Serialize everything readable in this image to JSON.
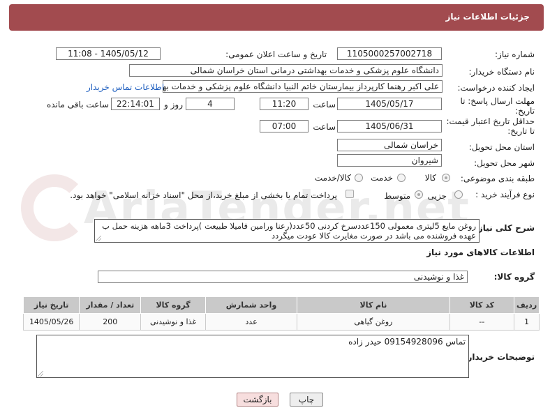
{
  "header": {
    "title": "جزئیات اطلاعات نیاز"
  },
  "fields": {
    "need_number_label": "شماره نیاز:",
    "need_number": "1105000257002718",
    "announce_label": "تاریخ و ساعت اعلان عمومی:",
    "announce_value": "1405/05/12 - 11:08",
    "buyer_org_label": "نام دستگاه خریدار:",
    "buyer_org": "دانشگاه علوم پزشکی و خدمات بهداشتی درمانی استان خراسان شمالی",
    "creator_label": "ایجاد کننده درخواست:",
    "creator": "علی اکبر رهنما کارپرداز بیمارستان خاتم النبیا دانشگاه علوم پزشکی و خدمات بهداشتی",
    "contact_link": "اطلاعات تماس خریدار",
    "reply_deadline_label_1": "مهلت ارسال پاسخ: تا",
    "reply_deadline_label_2": "تاریخ:",
    "reply_date": "1405/05/17",
    "time_label": "ساعت",
    "reply_time": "11:20",
    "days_value": "4",
    "days_label": "روز و",
    "remaining_time": "22:14:01",
    "remaining_label": "ساعت باقی مانده",
    "price_validity_label_1": "حداقل تاریخ اعتبار قیمت:",
    "price_validity_label_2": "تا تاریخ:",
    "price_date": "1405/06/31",
    "price_time": "07:00",
    "province_label": "استان محل تحویل:",
    "province": "خراسان شمالی",
    "city_label": "شهر محل تحویل:",
    "city": "شیروان",
    "category_label": "طبقه بندی موضوعی:",
    "category_options": [
      "کالا",
      "خدمت",
      "کالا/خدمت"
    ],
    "process_label": "نوع فرآیند خرید :",
    "process_options": [
      "جزیی",
      "متوسط"
    ],
    "payment_note": "پرداخت تمام یا بخشی از مبلغ خرید،از محل \"اسناد خزانه اسلامی\" خواهد بود."
  },
  "description": {
    "label": "شرح کلی نیاز:",
    "text": "روغن مایع 5لیتری معمولی 150عددسرخ کردنی 50عدد(رعنا ورامین فامیلا طبیعت )پرداخت 3ماهه هزینه حمل ب عهده فروشنده می باشد در صورت مغایرت کالا عودت میگردد"
  },
  "goods_info": {
    "title": "اطلاعات کالاهای مورد نیاز"
  },
  "goods_group": {
    "label": "گروه کالا:",
    "value": "غذا و نوشیدنی"
  },
  "table": {
    "headers": [
      "ردیف",
      "کد کالا",
      "نام کالا",
      "واحد شمارش",
      "گروه کالا",
      "تعداد / مقدار",
      "تاریخ نیاز"
    ],
    "rows": [
      [
        "1",
        "--",
        "روغن گیاهی",
        "عدد",
        "غذا و نوشیدنی",
        "200",
        "1405/05/26"
      ]
    ]
  },
  "buyer_notes": {
    "label": "توضیحات خریدار:",
    "text": "تماس 09154928096 حیدر زاده"
  },
  "buttons": {
    "print": "چاپ",
    "back": "بازگشت"
  },
  "watermark": "AriaTender.net"
}
